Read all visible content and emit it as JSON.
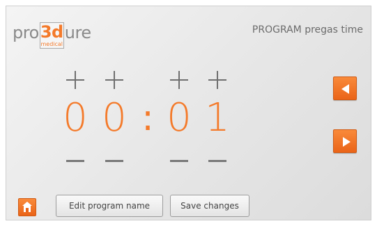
{
  "logo": {
    "prefix": "pro",
    "highlight": "3d",
    "highlight_sub": "medical",
    "suffix": "ure"
  },
  "header": {
    "title": "PROGRAM pregas time"
  },
  "timer": {
    "digits": [
      "0",
      "0",
      "0",
      "1"
    ],
    "separator": ":"
  },
  "buttons": {
    "edit_name": "Edit program name",
    "save": "Save changes"
  },
  "icons": {
    "increment": "plus-icon",
    "decrement": "minus-icon",
    "prev": "arrow-left-icon",
    "next": "arrow-right-icon",
    "home": "home-icon"
  },
  "colors": {
    "accent": "#f47a2a",
    "text": "#6b6b6b"
  }
}
